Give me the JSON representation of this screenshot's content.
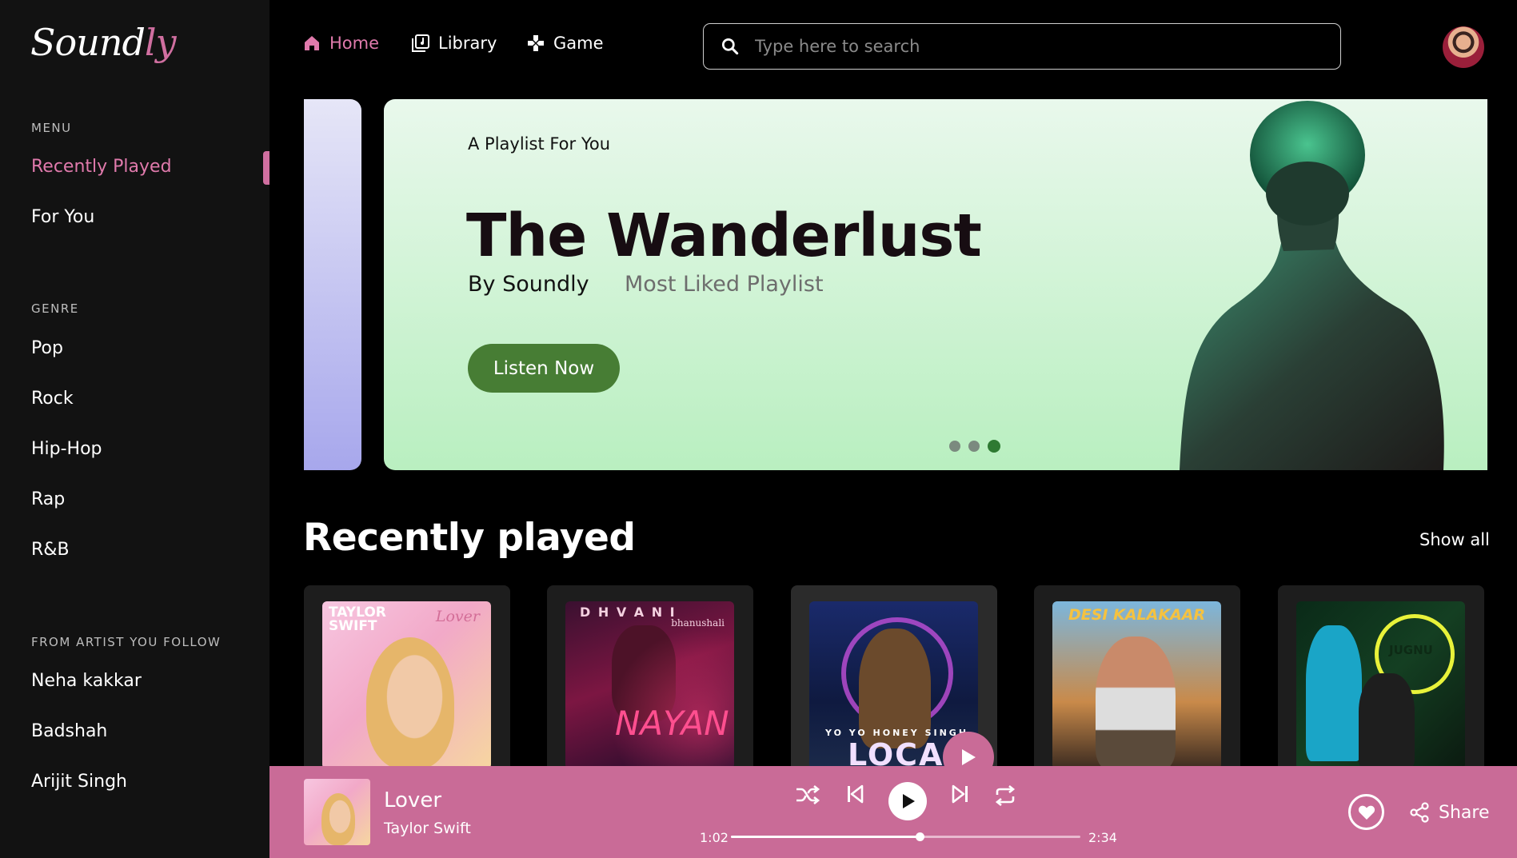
{
  "brand": {
    "logo_main": "Sound",
    "logo_accent": "ly"
  },
  "sidebar": {
    "menu_label": "MENU",
    "menu_items": [
      "Recently Played",
      "For You"
    ],
    "genre_label": "GENRE",
    "genres": [
      "Pop",
      "Rock",
      "Hip-Hop",
      "Rap",
      "R&B"
    ],
    "artists_label": "FROM ARTIST YOU FOLLOW",
    "artists": [
      "Neha kakkar",
      "Badshah",
      "Arijit Singh"
    ]
  },
  "nav": {
    "home": "Home",
    "library": "Library",
    "game": "Game"
  },
  "search": {
    "placeholder": "Type here to search"
  },
  "banner": {
    "eyebrow": "A Playlist For You",
    "title": "The Wanderlust",
    "by": "By Soundly",
    "subtitle": "Most Liked Playlist",
    "cta": "Listen Now",
    "active_slide": 3,
    "slide_count": 3
  },
  "recently_played": {
    "title": "Recently played",
    "show_all": "Show all",
    "cards": [
      {
        "cover_text_1": "TAYLOR",
        "cover_text_2": "SWIFT",
        "cover_text_3": "Lover"
      },
      {
        "cover_text_1": "D H V A N I",
        "cover_text_2": "bhanushali",
        "cover_text_3": "NAYAN"
      },
      {
        "cover_text_1": "YO YO HONEY SINGH",
        "cover_text_2": "LOCA"
      },
      {
        "cover_text_1": "DESI KALAKAAR"
      },
      {
        "cover_text_1": "JUGNU"
      }
    ]
  },
  "player": {
    "title": "Lover",
    "artist": "Taylor Swift",
    "current_time": "1:02",
    "total_time": "2:34",
    "progress": 0.54,
    "share": "Share",
    "colors": {
      "bar": "#c96b97",
      "accent": "#e07aac"
    }
  }
}
